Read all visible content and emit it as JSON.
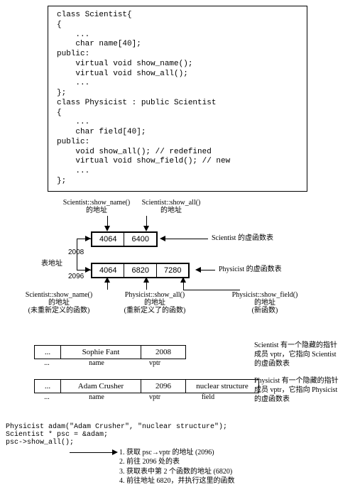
{
  "code": "class Scientist{\n{\n    ...\n    char name[40];\npublic:\n    virtual void show_name();\n    virtual void show_all();\n    ...\n};\nclass Physicist : public Scientist\n{\n    ...\n    char field[40];\npublic:\n    void show_all(); // redefined\n    virtual void show_field(); // new\n    ...\n};",
  "labels": {
    "sci_show_name": "Scientist::show_name()\n的地址",
    "sci_show_all": "Scientist::show_all()\n的地址",
    "sci_vtable_caption": "Scientist 的虚函数表",
    "phy_vtable_caption": "Physicist 的虚函数表",
    "table_addr": "表地址",
    "sci_show_name_note": "Scientist::show_name()\n的地址\n(未重新定义的函数)",
    "phy_show_all_note": "Physicist::show_all()\n的地址\n(重新定义了的函数)",
    "phy_show_field_note": "Physicist::show_field()\n的地址\n(新函数)"
  },
  "vtables": {
    "scientist": [
      "4064",
      "6400"
    ],
    "physicist": [
      "4064",
      "6820",
      "7280"
    ],
    "addr_scientist": "2008",
    "addr_physicist": "2096"
  },
  "objects": {
    "sophie": {
      "ell": "...",
      "name": "Sophie Fant",
      "vptr": "2008"
    },
    "adam": {
      "ell": "...",
      "name": "Adam Crusher",
      "vptr": "2096",
      "field": "nuclear structure"
    },
    "sub_ell": "...",
    "sub_name": "name",
    "sub_vptr": "vptr",
    "sub_field": "field"
  },
  "side": {
    "sci": "Scientist 有一个隐藏的指针成员 vptr，它指向 Scientist 的虚函数表",
    "phy": "Physicist 有一个隐藏的指针成员 vptr，它指向 Physicist 的虚函数表"
  },
  "bottom_code": "Physicist adam(\"Adam Crusher\", \"nuclear structure\");\nScientist * psc = &adam;\npsc->show_all();",
  "steps": [
    "1. 获取 psc→vptr 的地址 (2096)",
    "2. 前往 2096 处的表",
    "3. 获取表中第 2 个函数的地址 (6820)",
    "4. 前往地址 6820，并执行这里的函数"
  ]
}
